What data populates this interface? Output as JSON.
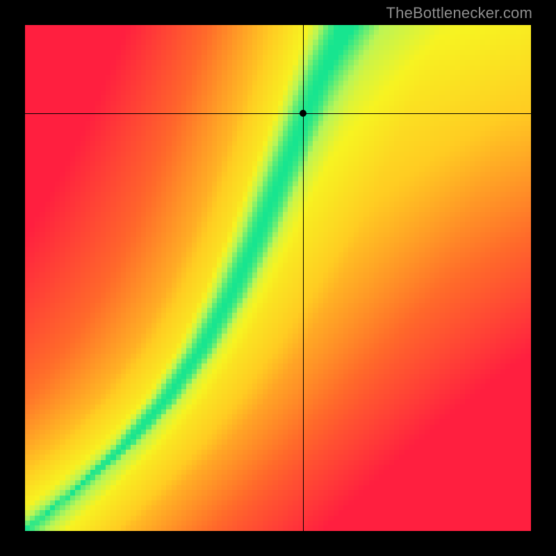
{
  "watermark": "TheBottlenecker.com",
  "chart_data": {
    "type": "heatmap",
    "title": "",
    "xlabel": "",
    "ylabel": "",
    "xlim": [
      0,
      100
    ],
    "ylim": [
      0,
      100
    ],
    "grid_resolution": 100,
    "colorscale": [
      {
        "t": 0.0,
        "hex": "#ff1f3f"
      },
      {
        "t": 0.25,
        "hex": "#ff6a2a"
      },
      {
        "t": 0.5,
        "hex": "#ffcc22"
      },
      {
        "t": 0.7,
        "hex": "#f7f321"
      },
      {
        "t": 0.85,
        "hex": "#b8f558"
      },
      {
        "t": 1.0,
        "hex": "#17e58f"
      }
    ],
    "ridge_points": [
      {
        "x": 0,
        "y": 0
      },
      {
        "x": 10,
        "y": 8
      },
      {
        "x": 20,
        "y": 17
      },
      {
        "x": 28,
        "y": 26
      },
      {
        "x": 35,
        "y": 36
      },
      {
        "x": 41,
        "y": 47
      },
      {
        "x": 46,
        "y": 58
      },
      {
        "x": 50,
        "y": 68
      },
      {
        "x": 54,
        "y": 78
      },
      {
        "x": 58,
        "y": 88
      },
      {
        "x": 63,
        "y": 100
      }
    ],
    "ridge_width_at": [
      {
        "y": 0,
        "w": 1.0
      },
      {
        "y": 20,
        "w": 4.5
      },
      {
        "y": 50,
        "w": 6.0
      },
      {
        "y": 80,
        "w": 7.0
      },
      {
        "y": 100,
        "w": 8.0
      }
    ],
    "far_field_floor_at": [
      {
        "dist": 0,
        "score": 1.0
      },
      {
        "dist": 8,
        "score": 0.72
      },
      {
        "dist": 20,
        "score": 0.52
      },
      {
        "dist": 40,
        "score": 0.34
      },
      {
        "dist": 70,
        "score": 0.14
      },
      {
        "dist": 100,
        "score": 0.02
      }
    ],
    "corner_bias": {
      "bottom_right_penalty": 0.4,
      "top_left_penalty": 0.28,
      "top_right_boost": 0.3
    },
    "crosshair": {
      "x": 55,
      "y": 82.5
    },
    "marker": {
      "x": 55,
      "y": 82.5
    },
    "legend": null,
    "annotations": []
  }
}
